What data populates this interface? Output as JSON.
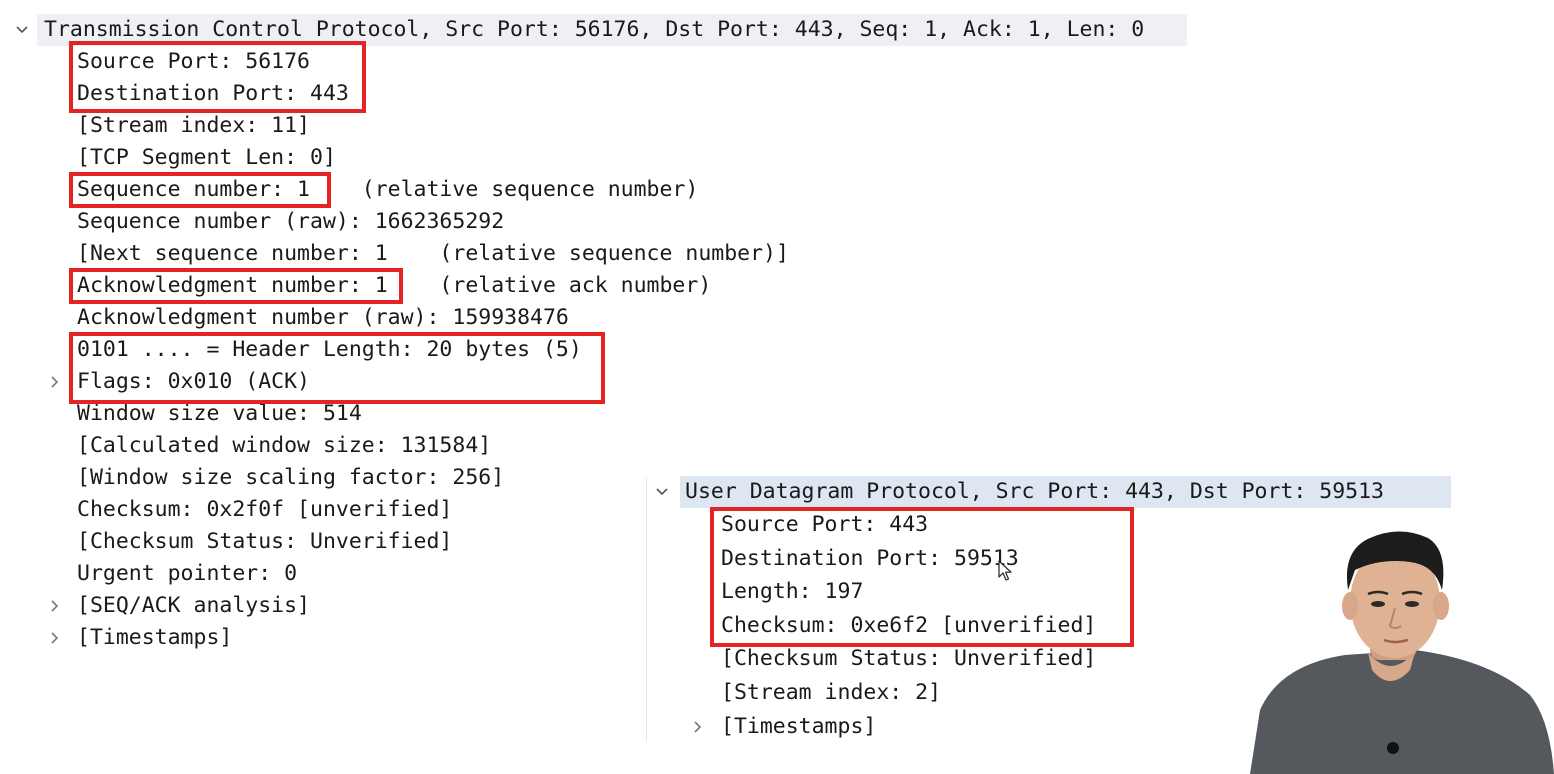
{
  "tcp": {
    "header": "Transmission Control Protocol, Src Port: 56176, Dst Port: 443, Seq: 1, Ack: 1, Len: 0",
    "fields": [
      "Source Port: 56176",
      "Destination Port: 443",
      "[Stream index: 11]",
      "[TCP Segment Len: 0]",
      "Sequence number: 1    (relative sequence number)",
      "Sequence number (raw): 1662365292",
      "[Next sequence number: 1    (relative sequence number)]",
      "Acknowledgment number: 1    (relative ack number)",
      "Acknowledgment number (raw): 159938476",
      "0101 .... = Header Length: 20 bytes (5)",
      "Flags: 0x010 (ACK)",
      "Window size value: 514",
      "[Calculated window size: 131584]",
      "[Window size scaling factor: 256]",
      "Checksum: 0x2f0f [unverified]",
      "[Checksum Status: Unverified]",
      "Urgent pointer: 0",
      "[SEQ/ACK analysis]",
      "[Timestamps]"
    ]
  },
  "udp": {
    "header": "User Datagram Protocol, Src Port: 443, Dst Port: 59513",
    "fields": [
      "Source Port: 443",
      "Destination Port: 59513",
      "Length: 197",
      "Checksum: 0xe6f2 [unverified]",
      "[Checksum Status: Unverified]",
      "[Stream index: 2]",
      "[Timestamps]"
    ]
  },
  "icons": {
    "expanded": "chevron-down-icon",
    "collapsed": "chevron-right-icon",
    "cursor": "mouse-pointer-icon"
  },
  "colors": {
    "highlight": "#e32424",
    "tcp_header_bg": "#eef0f3",
    "udp_header_bg": "#dde6f1",
    "text": "#1a1a1a"
  }
}
